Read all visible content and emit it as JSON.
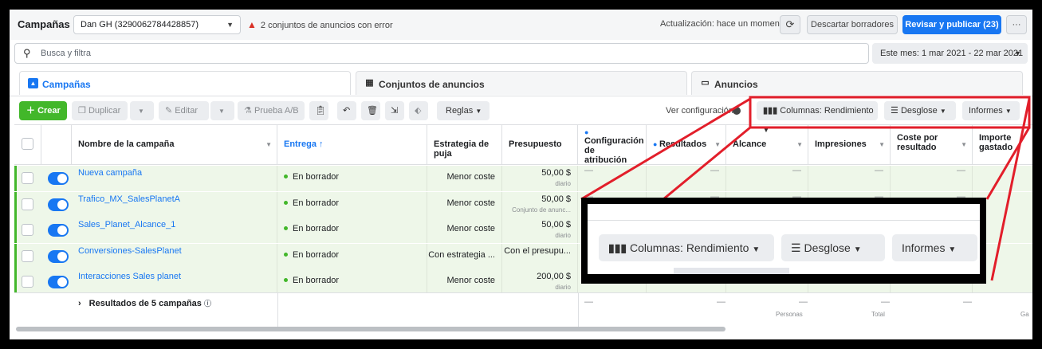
{
  "topbar": {
    "title": "Campañas",
    "account": "Dan GH (3290062784428857)",
    "error_text": "2 conjuntos de anuncios con error",
    "update_text": "Actualización: hace un momento",
    "discard_label": "Descartar borradores",
    "publish_label": "Revisar y publicar (23)",
    "more_label": "···"
  },
  "search": {
    "placeholder": "Busca y filtra"
  },
  "daterange": "Este mes: 1 mar 2021 - 22 mar 2021",
  "tabs": [
    {
      "label": "Campañas"
    },
    {
      "label": "Conjuntos de anuncios"
    },
    {
      "label": "Anuncios"
    }
  ],
  "toolbar": {
    "create": "Crear",
    "duplicate": "Duplicar",
    "edit": "Editar",
    "abtest": "Prueba A/B",
    "rules": "Reglas",
    "view_config": "Ver configuración",
    "columns": "Columnas: Rendimiento",
    "breakdown": "Desglose",
    "reports": "Informes"
  },
  "table": {
    "headers": {
      "name": "Nombre de la campaña",
      "delivery": "Entrega ↑",
      "bid": "Estrategia de puja",
      "budget": "Presupuesto",
      "attribution": "Configuración de atribución",
      "results": "Resultados",
      "reach": "Alcance",
      "impressions": "Impresiones",
      "cost": "Coste por resultado",
      "spent": "Importe gastado"
    },
    "rows": [
      {
        "name": "Nueva campaña",
        "delivery": "En borrador",
        "bid": "Menor coste",
        "budget": "50,00 $",
        "budget_sub": "diario"
      },
      {
        "name": "Trafico_MX_SalesPlanetA",
        "delivery": "En borrador",
        "bid": "Menor coste",
        "budget": "50,00 $",
        "budget_sub": "Conjunto de anunc..."
      },
      {
        "name": "Sales_Planet_Alcance_1",
        "delivery": "En borrador",
        "bid": "Menor coste",
        "budget": "50,00 $",
        "budget_sub": "diario"
      },
      {
        "name": "Conversiones-SalesPlanet",
        "delivery": "En borrador",
        "bid": "Con estrategia ...",
        "budget": "Con el presupu...",
        "budget_sub": ""
      },
      {
        "name": "Interacciones Sales planet",
        "delivery": "En borrador",
        "bid": "Menor coste",
        "budget": "200,00 $",
        "budget_sub": "diario"
      }
    ],
    "dash": "—",
    "total": {
      "label": "Resultados de 5 campañas",
      "reach_sub": "Personas",
      "cost_sub": "Total",
      "spent_sub": "Ga"
    }
  },
  "zoom": {
    "columns": "Columnas: Rendimiento",
    "breakdown": "Desglose",
    "reports": "Informes"
  },
  "colors": {
    "accent": "#1877f2",
    "highlight": "#e21e2a",
    "draft_bg": "#eef7e9"
  }
}
